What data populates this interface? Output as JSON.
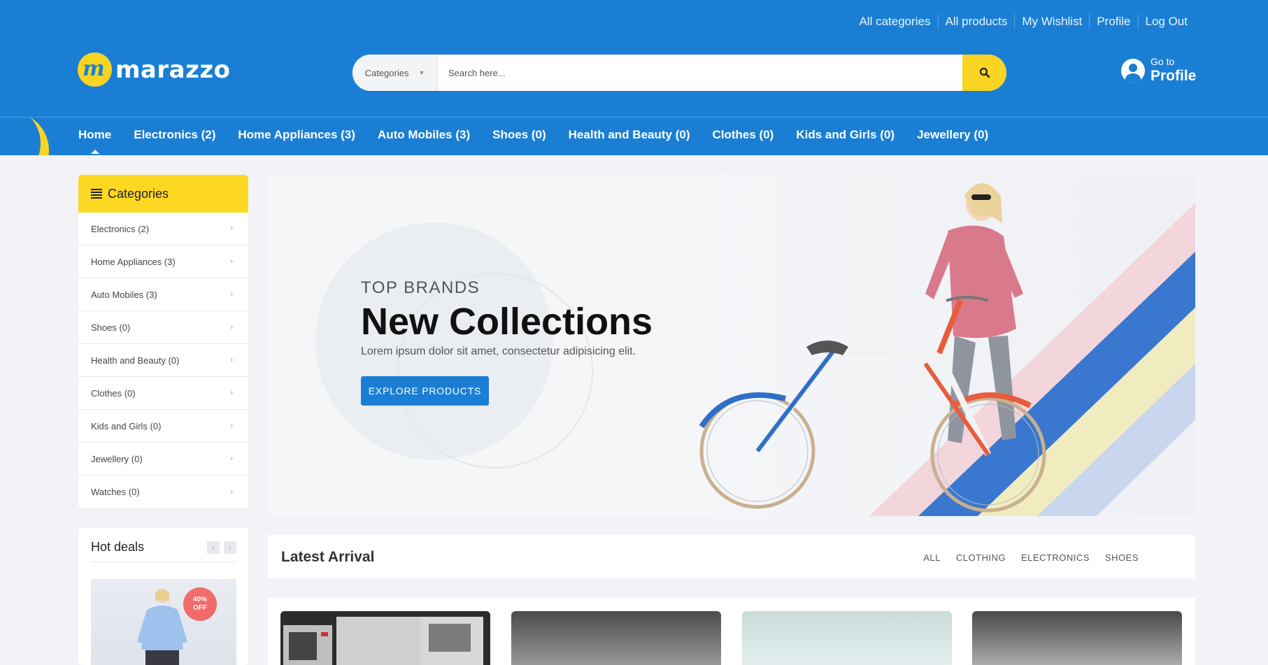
{
  "topnav": {
    "items": [
      "All categories",
      "All products",
      "My Wishlist",
      "Profile",
      "Log Out"
    ]
  },
  "brand": {
    "name": "marazzo",
    "mark": "m"
  },
  "search": {
    "category_label": "Categories",
    "placeholder": "Search here..."
  },
  "account": {
    "small": "Go to",
    "big": "Profile"
  },
  "mainnav": {
    "items": [
      "Home",
      "Electronics (2)",
      "Home Appliances (3)",
      "Auto Mobiles (3)",
      "Shoes (0)",
      "Health and Beauty (0)",
      "Clothes (0)",
      "Kids and Girls (0)",
      "Jewellery (0)"
    ]
  },
  "sidebar": {
    "title": "Categories",
    "items": [
      "Electronics (2)",
      "Home Appliances (3)",
      "Auto Mobiles (3)",
      "Shoes (0)",
      "Health and Beauty (0)",
      "Clothes (0)",
      "Kids and Girls (0)",
      "Jewellery (0)",
      "Watches (0)"
    ]
  },
  "hot_deals": {
    "title": "Hot deals",
    "badge_pct": "40%",
    "badge_off": "OFF"
  },
  "hero": {
    "subtitle": "TOP BRANDS",
    "title": "New Collections",
    "description": "Lorem ipsum dolor sit amet, consectetur adipisicing elit.",
    "button": "EXPLORE PRODUCTS"
  },
  "latest": {
    "title": "Latest Arrival",
    "tabs": [
      "ALL",
      "CLOTHING",
      "ELECTRONICS",
      "SHOES"
    ]
  },
  "colors": {
    "header_blue": "#1a7fd4",
    "accent_yellow": "#fdd823",
    "badge_red": "#f26b6b"
  }
}
